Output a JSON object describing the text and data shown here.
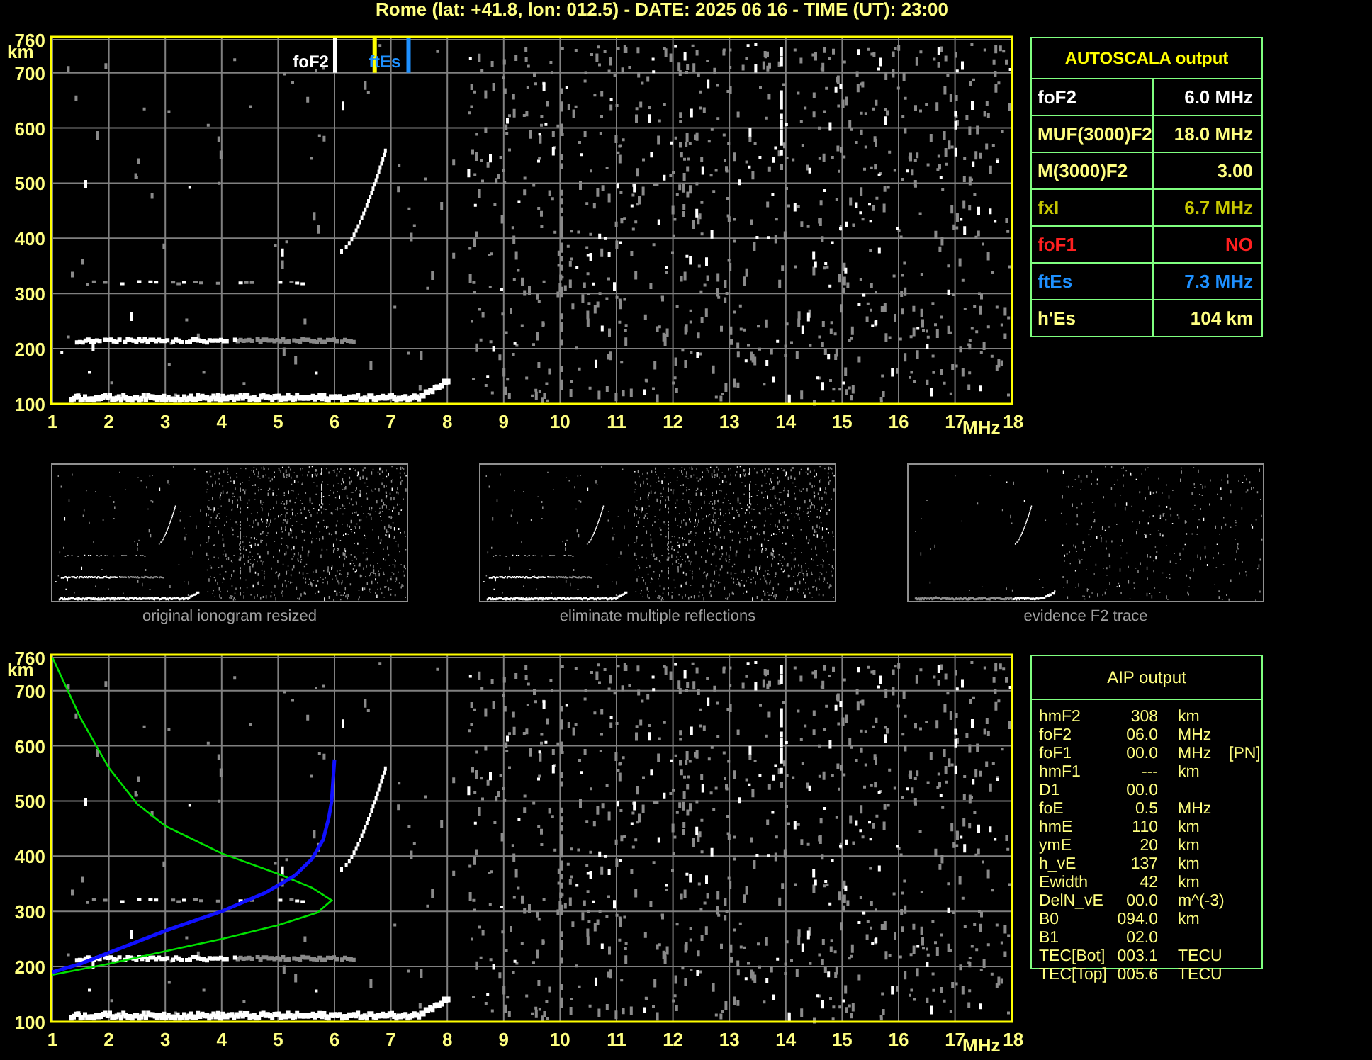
{
  "title": "Rome (lat: +41.8, lon: 012.5) - DATE: 2025 06 16 - TIME (UT): 23:00",
  "ionogram": {
    "axes": {
      "y_ticks": [
        "760",
        "700",
        "600",
        "500",
        "400",
        "300",
        "200",
        "100"
      ],
      "y_unit": "km",
      "x_ticks": [
        "1",
        "2",
        "3",
        "4",
        "5",
        "6",
        "7",
        "8",
        "9",
        "10",
        "11",
        "12",
        "13",
        "14",
        "15",
        "16",
        "17",
        "18"
      ],
      "x_unit": "MHz"
    },
    "markers": [
      {
        "label": "foF2",
        "color": "#ffffff",
        "level": 0.2941
      },
      {
        "color": "#ffff00",
        "level": 0.3353
      },
      {
        "label": "ftEs",
        "color": "#1e90ff",
        "level": 0.3706
      }
    ]
  },
  "autoscala": {
    "title": "AUTOSCALA output",
    "rows": [
      {
        "name": "foF2",
        "value": "6.0 MHz",
        "color": "#ffffff"
      },
      {
        "name": "MUF(3000)F2",
        "value": "18.0 MHz",
        "color": "#ffff80"
      },
      {
        "name": "M(3000)F2",
        "value": "3.00",
        "color": "#ffff80"
      },
      {
        "name": "fxI",
        "value": "6.7 MHz",
        "color": "#c8c800"
      },
      {
        "name": "foF1",
        "value": "NO",
        "color": "#ff2020"
      },
      {
        "name": "ftEs",
        "value": "7.3 MHz",
        "color": "#1e90ff"
      },
      {
        "name": "h'Es",
        "value": "104 km",
        "color": "#ffff80"
      }
    ]
  },
  "thumbnails": [
    {
      "caption": "original ionogram resized",
      "kind": "full"
    },
    {
      "caption": "eliminate multiple reflections",
      "kind": "full"
    },
    {
      "caption": "evidence F2 trace",
      "kind": "trace"
    }
  ],
  "profile_plot": {
    "axes": {
      "y_ticks": [
        "760",
        "700",
        "600",
        "500",
        "400",
        "300",
        "200",
        "100"
      ],
      "y_unit": "km",
      "x_ticks": [
        "1",
        "2",
        "3",
        "4",
        "5",
        "6",
        "7",
        "8",
        "9",
        "10",
        "11",
        "12",
        "13",
        "14",
        "15",
        "16",
        "17",
        "18"
      ],
      "x_unit": "MHz"
    }
  },
  "aip": {
    "title": "AIP output",
    "rows": [
      {
        "name": "hmF2",
        "value": "308",
        "unit": "km"
      },
      {
        "name": "foF2",
        "value": "06.0",
        "unit": "MHz"
      },
      {
        "name": "foF1",
        "value": "00.0",
        "unit": "MHz",
        "note": "[PN]"
      },
      {
        "name": "hmF1",
        "value": "---",
        "unit": "km"
      },
      {
        "name": "D1",
        "value": "00.0"
      },
      {
        "name": "foE",
        "value": "0.5",
        "unit": "MHz"
      },
      {
        "name": "hmE",
        "value": "110",
        "unit": "km"
      },
      {
        "name": "ymE",
        "value": "20",
        "unit": "km"
      },
      {
        "name": "h_vE",
        "value": "137",
        "unit": "km"
      },
      {
        "name": "Ewidth",
        "value": "42",
        "unit": "km"
      },
      {
        "name": "DelN_vE",
        "value": "00.0",
        "unit": "m^(-3)"
      },
      {
        "name": "B0",
        "value": "094.0",
        "unit": "km"
      },
      {
        "name": "B1",
        "value": "02.0"
      },
      {
        "name": "TEC[Bot]",
        "value": "003.1",
        "unit": "TECU"
      },
      {
        "name": "TEC[Top]",
        "value": "005.6",
        "unit": "TECU"
      }
    ]
  }
}
